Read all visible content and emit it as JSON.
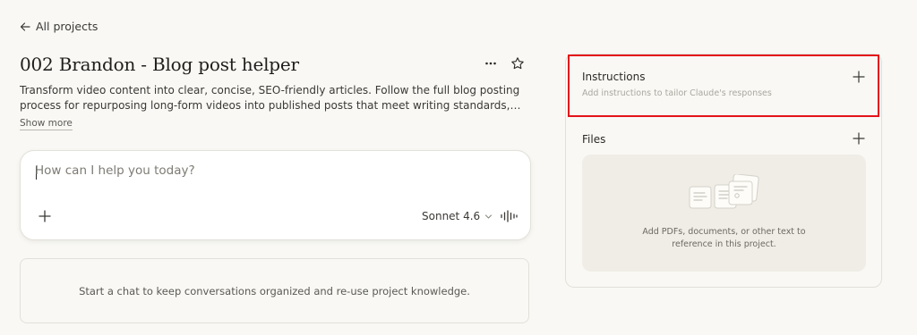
{
  "nav": {
    "back_label": "All projects"
  },
  "project": {
    "title": "002 Brandon - Blog post helper",
    "description": "Transform video content into clear, concise, SEO-friendly articles. Follow the full blog posting process for repurposing long-form videos into published posts that meet writing standards, EEAT guidelines, and…",
    "show_more_label": "Show more"
  },
  "chat": {
    "placeholder": "How can I help you today?",
    "model": "Sonnet 4.6"
  },
  "empty_state": {
    "text": "Start a chat to keep conversations organized and re-use project knowledge."
  },
  "instructions": {
    "title": "Instructions",
    "subtitle": "Add instructions to tailor Claude's responses",
    "highlight_color": "#e3131a"
  },
  "files": {
    "title": "Files",
    "drop_line1": "Add PDFs, documents, or other text to",
    "drop_line2": "reference in this project."
  },
  "icons": [
    "arrow-left-icon",
    "more-horizontal-icon",
    "star-icon",
    "plus-icon",
    "chevron-down-icon",
    "voice-waveform-icon",
    "documents-illustration"
  ]
}
